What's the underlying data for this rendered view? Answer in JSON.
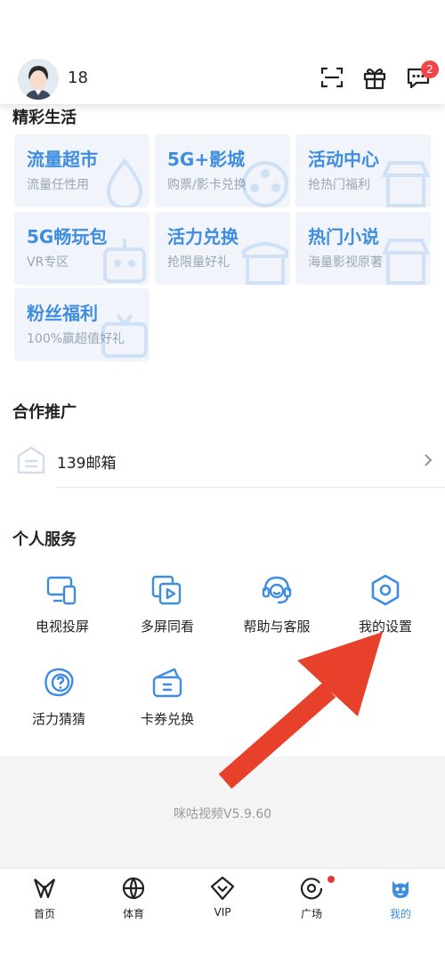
{
  "header": {
    "username": "18",
    "message_badge": "2"
  },
  "colors": {
    "accent": "#3f8de0",
    "tile_bg": "#f1f5fb",
    "badge": "#f0464a",
    "annotation_arrow": "#e8412b"
  },
  "featured": {
    "title": "精彩生活",
    "tiles": [
      {
        "title": "流量超市",
        "sub": "流量任性用",
        "icon": "drop-icon"
      },
      {
        "title": "5G+影城",
        "sub": "购票/影卡兑换",
        "icon": "film-reel-icon"
      },
      {
        "title": "活动中心",
        "sub": "抢热门福利",
        "icon": "shop-icon"
      },
      {
        "title": "5G畅玩包",
        "sub": "VR专区",
        "icon": "robot-icon"
      },
      {
        "title": "活力兑换",
        "sub": "抢限量好礼",
        "icon": "store-icon"
      },
      {
        "title": "热门小说",
        "sub": "海量影视原著",
        "icon": "shop-icon"
      },
      {
        "title": "粉丝福利",
        "sub": "100%赢超值好礼",
        "icon": "tv-icon"
      }
    ]
  },
  "promotion": {
    "title": "合作推广",
    "items": [
      {
        "label": "139邮箱",
        "icon": "mailbox-icon"
      }
    ]
  },
  "services": {
    "title": "个人服务",
    "items": [
      {
        "label": "电视投屏",
        "icon": "cast-screen-icon"
      },
      {
        "label": "多屏同看",
        "icon": "multi-screen-icon"
      },
      {
        "label": "帮助与客服",
        "icon": "headset-icon"
      },
      {
        "label": "我的设置",
        "icon": "settings-hexagon-icon"
      },
      {
        "label": "活力猜猜",
        "icon": "question-badge-icon"
      },
      {
        "label": "卡券兑换",
        "icon": "wallet-icon"
      }
    ]
  },
  "footer": {
    "version": "咪咕视频V5.9.60"
  },
  "tabbar": {
    "items": [
      {
        "label": "首页",
        "icon": "home-logo-icon",
        "active": false
      },
      {
        "label": "体育",
        "icon": "basketball-icon",
        "active": false
      },
      {
        "label": "VIP",
        "icon": "vip-diamond-icon",
        "active": false
      },
      {
        "label": "广场",
        "icon": "plaza-icon",
        "active": false,
        "has_dot": true
      },
      {
        "label": "我的",
        "icon": "profile-mascot-icon",
        "active": true
      }
    ]
  }
}
